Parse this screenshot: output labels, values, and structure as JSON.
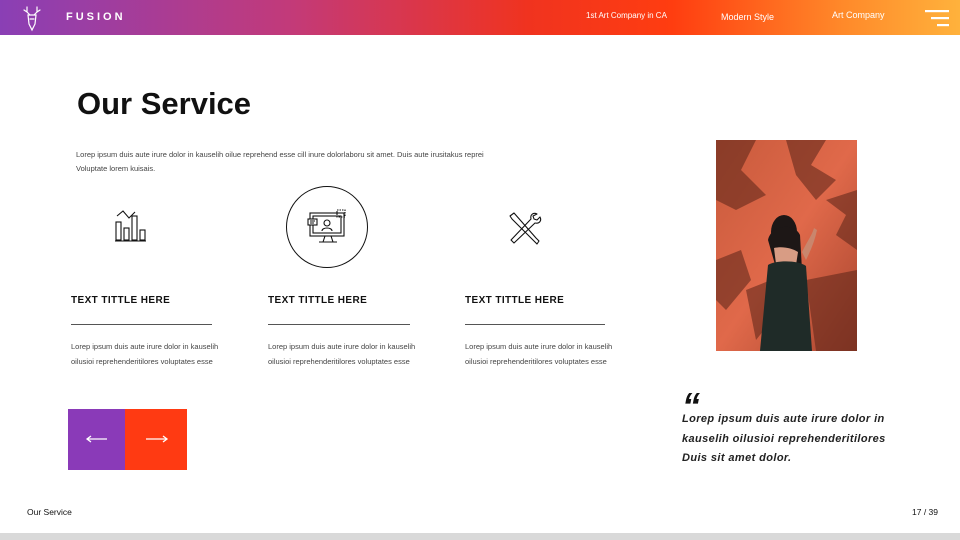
{
  "header": {
    "brand": "FUSION",
    "nav": [
      "1st Art Company in CA",
      "Modern Style",
      "Art Company"
    ],
    "logo_icon": "deer-head-icon",
    "menu_icon": "hamburger-menu-icon",
    "gradient_colors": [
      "#8a3fb5",
      "#ff3d10",
      "#ffb23c"
    ]
  },
  "main": {
    "title": "Our Service",
    "intro": "Lorep  ipsum duis aute irure dolor in kauselih oilue reprehend esse cill inure dolorlaboru sit amet. Duis aute irusitakus reprei Voluptate lorem kuisais."
  },
  "services": [
    {
      "icon": "bar-chart-icon",
      "title": "TEXT TITTLE HERE",
      "text": "Lorep  ipsum duis aute irure dolor in kauselih oilusioi reprehenderitilores voluptates esse"
    },
    {
      "icon": "monitor-user-icon",
      "title": "TEXT TITTLE HERE",
      "text": "Lorep  ipsum duis aute irure dolor in kauselih oilusioi reprehenderitilores voluptates esse"
    },
    {
      "icon": "wrench-screwdriver-icon",
      "title": "TEXT TITTLE HERE",
      "text": "Lorep  ipsum duis aute irure dolor in kauselih oilusioi reprehenderitilores voluptates esse"
    }
  ],
  "navigation": {
    "prev_icon": "arrow-left-icon",
    "next_icon": "arrow-right-icon",
    "prev_color": "#8a3ab8",
    "next_color": "#ff3a12"
  },
  "quote": {
    "mark": "“",
    "text": "Lorep  ipsum duis aute irure dolor in kauselih oilusioi reprehenderitilores Duis sit amet dolor."
  },
  "footer": {
    "label": "Our Service",
    "page": "17 / 39"
  }
}
